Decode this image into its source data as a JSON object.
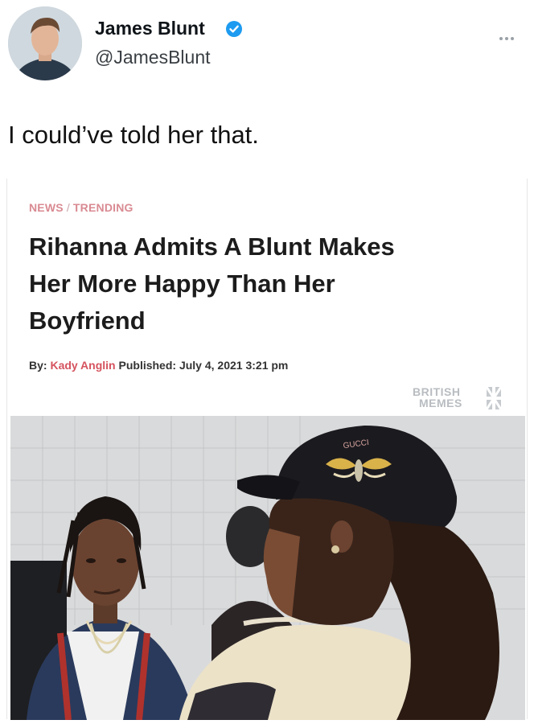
{
  "tweet": {
    "author_name": "James Blunt",
    "author_handle": "@JamesBlunt",
    "text": "I could’ve told her that.",
    "avatar_icon": "user-avatar",
    "verified_icon": "verified-badge-icon",
    "more_icon": "more-dots-icon"
  },
  "article": {
    "breadcrumb": [
      "NEWS",
      "TRENDING"
    ],
    "breadcrumb_separator": "/",
    "headline_lines": [
      "Rihanna Admits A Blunt Makes",
      "Her More Happy Than Her",
      "Boyfriend"
    ],
    "by_label": "By:",
    "author": "Kady Anglin",
    "published_label": "Published:",
    "published_date": "July 4, 2021 3:21 pm",
    "watermark_line1": "BRITISH",
    "watermark_line2": "MEMES",
    "photo_icon": "article-photo",
    "cap_text": "GUCCI"
  },
  "colors": {
    "accent_author": "#d5535e",
    "breadcrumb": "#d98a92",
    "verified": "#1d9bf0"
  }
}
